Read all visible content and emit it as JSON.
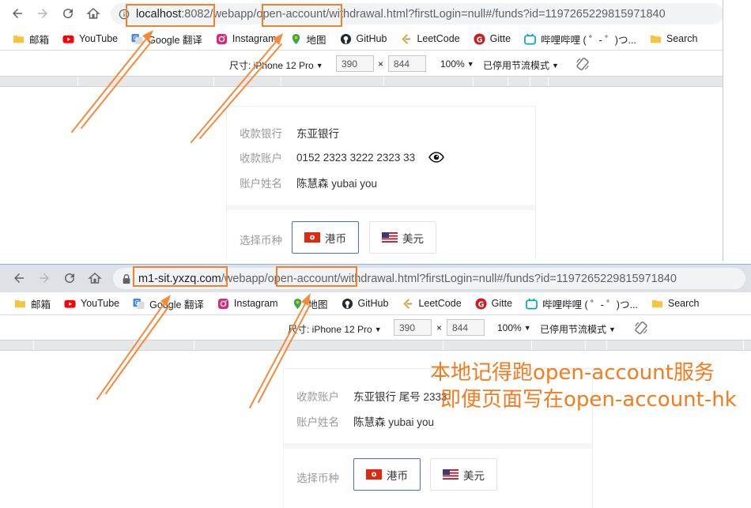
{
  "top_screenshot": {
    "url": {
      "host": "localhost",
      "port": ":8082",
      "path_sep1": "/",
      "path_webapp": "webapp",
      "path_sep2": "/",
      "path_module": "open-account",
      "path_rest": "/withdrawal.html?firstLogin=null#/funds?id=1197265229815971840"
    },
    "bookmarks": [
      "邮箱",
      "YouTube",
      "Google 翻译",
      "Instagram",
      "地图",
      "GitHub",
      "LeetCode",
      "Gitte",
      "哔哩哔哩 ( ゜- ゜)つ...",
      "Search"
    ],
    "device_toolbar": {
      "size_label": "尺寸: iPhone 12 Pro",
      "width": "390",
      "times": "×",
      "height": "844",
      "zoom": "100%",
      "throttle": "已停用节流模式"
    },
    "info_rows": [
      {
        "label": "收款银行",
        "value": "东亚银行"
      },
      {
        "label": "收款账户",
        "value": "0152 2323 3222 2323 33"
      },
      {
        "label": "账户姓名",
        "value": "陈慧森 yubai you"
      }
    ],
    "currency_label": "选择币种",
    "currencies": [
      "港币",
      "美元"
    ]
  },
  "bottom_screenshot": {
    "url": {
      "host": "m1-sit.yxzq.com",
      "path_sep1": "/",
      "path_webapp": "webapp",
      "path_sep2": "/",
      "path_module": "open-account",
      "path_rest": "/withdrawal.html?firstLogin=null#/funds?id=1197265229815971840"
    },
    "bookmarks": [
      "邮箱",
      "YouTube",
      "Google 翻译",
      "Instagram",
      "地图",
      "GitHub",
      "LeetCode",
      "Gitte",
      "哔哩哔哩 ( ゜- ゜)つ...",
      "Search"
    ],
    "device_toolbar": {
      "size_label": "尺寸: iPhone 12 Pro",
      "width": "390",
      "times": "×",
      "height": "844",
      "zoom": "100%",
      "throttle": "已停用节流模式"
    },
    "info_rows": [
      {
        "label": "收款账户",
        "value": "东亚银行 尾号 2333"
      },
      {
        "label": "账户姓名",
        "value": "陈慧森 yubai you"
      }
    ],
    "currency_label": "选择币种",
    "currencies": [
      "港币",
      "美元"
    ]
  },
  "annotation": {
    "line1": "本地记得跑open-account服务",
    "line2": "即便页面写在open-account-hk",
    "color": "#f47b20"
  },
  "colors": {
    "omnibox": "#f1f3f4",
    "active_border": "#3d73c8",
    "annotation_box": "#f0822f"
  }
}
